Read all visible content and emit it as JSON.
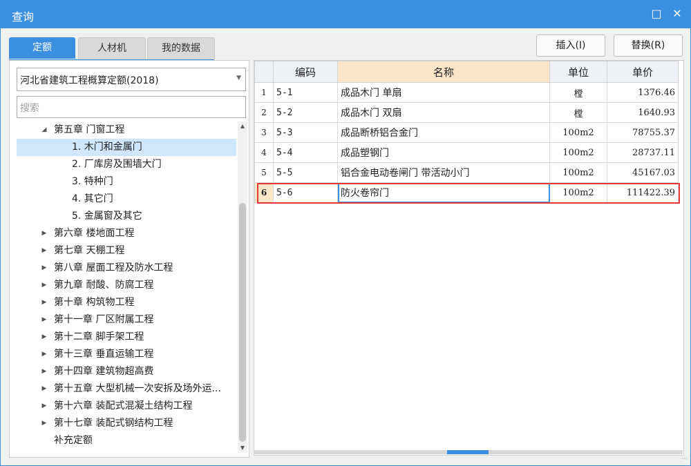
{
  "window": {
    "title": "查询",
    "maximize_icon": "maximize-icon",
    "close_icon": "close-icon"
  },
  "tabs": [
    {
      "label": "定额",
      "active": true
    },
    {
      "label": "人材机",
      "active": false
    },
    {
      "label": "我的数据",
      "active": false
    }
  ],
  "buttons": {
    "insert_label": "插入(I)",
    "replace_label": "替换(R)"
  },
  "library_select": {
    "value": "河北省建筑工程概算定额(2018)"
  },
  "search": {
    "placeholder": "搜索"
  },
  "tree": {
    "items": [
      {
        "label": "第五章 门窗工程",
        "level": 0,
        "expanded": true,
        "selected": false
      },
      {
        "label": "1. 木门和金属门",
        "level": 1,
        "selected": true
      },
      {
        "label": "2. 厂库房及围墙大门",
        "level": 1,
        "selected": false
      },
      {
        "label": "3. 特种门",
        "level": 1,
        "selected": false
      },
      {
        "label": "4. 其它门",
        "level": 1,
        "selected": false
      },
      {
        "label": "5. 金属窗及其它",
        "level": 1,
        "selected": false
      },
      {
        "label": "第六章 楼地面工程",
        "level": 0,
        "expanded": false
      },
      {
        "label": "第七章 天棚工程",
        "level": 0,
        "expanded": false
      },
      {
        "label": "第八章 屋面工程及防水工程",
        "level": 0,
        "expanded": false
      },
      {
        "label": "第九章 耐酸、防腐工程",
        "level": 0,
        "expanded": false
      },
      {
        "label": "第十章 构筑物工程",
        "level": 0,
        "expanded": false
      },
      {
        "label": "第十一章 厂区附属工程",
        "level": 0,
        "expanded": false
      },
      {
        "label": "第十二章 脚手架工程",
        "level": 0,
        "expanded": false
      },
      {
        "label": "第十三章 垂直运输工程",
        "level": 0,
        "expanded": false
      },
      {
        "label": "第十四章 建筑物超高费",
        "level": 0,
        "expanded": false
      },
      {
        "label": "第十五章 大型机械一次安拆及场外运...",
        "level": 0,
        "expanded": false
      },
      {
        "label": "第十六章 装配式混凝土结构工程",
        "level": 0,
        "expanded": false
      },
      {
        "label": "第十七章 装配式钢结构工程",
        "level": 0,
        "expanded": false
      },
      {
        "label": "补充定额",
        "level": 0,
        "leaf": true
      }
    ]
  },
  "grid": {
    "headers": {
      "code": "编码",
      "name": "名称",
      "unit": "单位",
      "price": "单价"
    },
    "rows": [
      {
        "idx": "1",
        "code": "5-1",
        "name": "成品木门 单扇",
        "unit": "樘",
        "price": "1376.46"
      },
      {
        "idx": "2",
        "code": "5-2",
        "name": "成品木门 双扇",
        "unit": "樘",
        "price": "1640.93"
      },
      {
        "idx": "3",
        "code": "5-3",
        "name": "成品断桥铝合金门",
        "unit": "100m2",
        "price": "78755.37"
      },
      {
        "idx": "4",
        "code": "5-4",
        "name": "成品塑钢门",
        "unit": "100m2",
        "price": "28737.11"
      },
      {
        "idx": "5",
        "code": "5-5",
        "name": "铝合金电动卷闸门 带活动小门",
        "unit": "100m2",
        "price": "45167.03"
      },
      {
        "idx": "6",
        "code": "5-6",
        "name": "防火卷帘门",
        "unit": "100m2",
        "price": "111422.39",
        "current": true
      }
    ]
  },
  "colors": {
    "accent": "#3a8fe0",
    "highlight": "#e53935",
    "header_highlight": "#fde5c8",
    "selection": "#cfe6fc"
  }
}
